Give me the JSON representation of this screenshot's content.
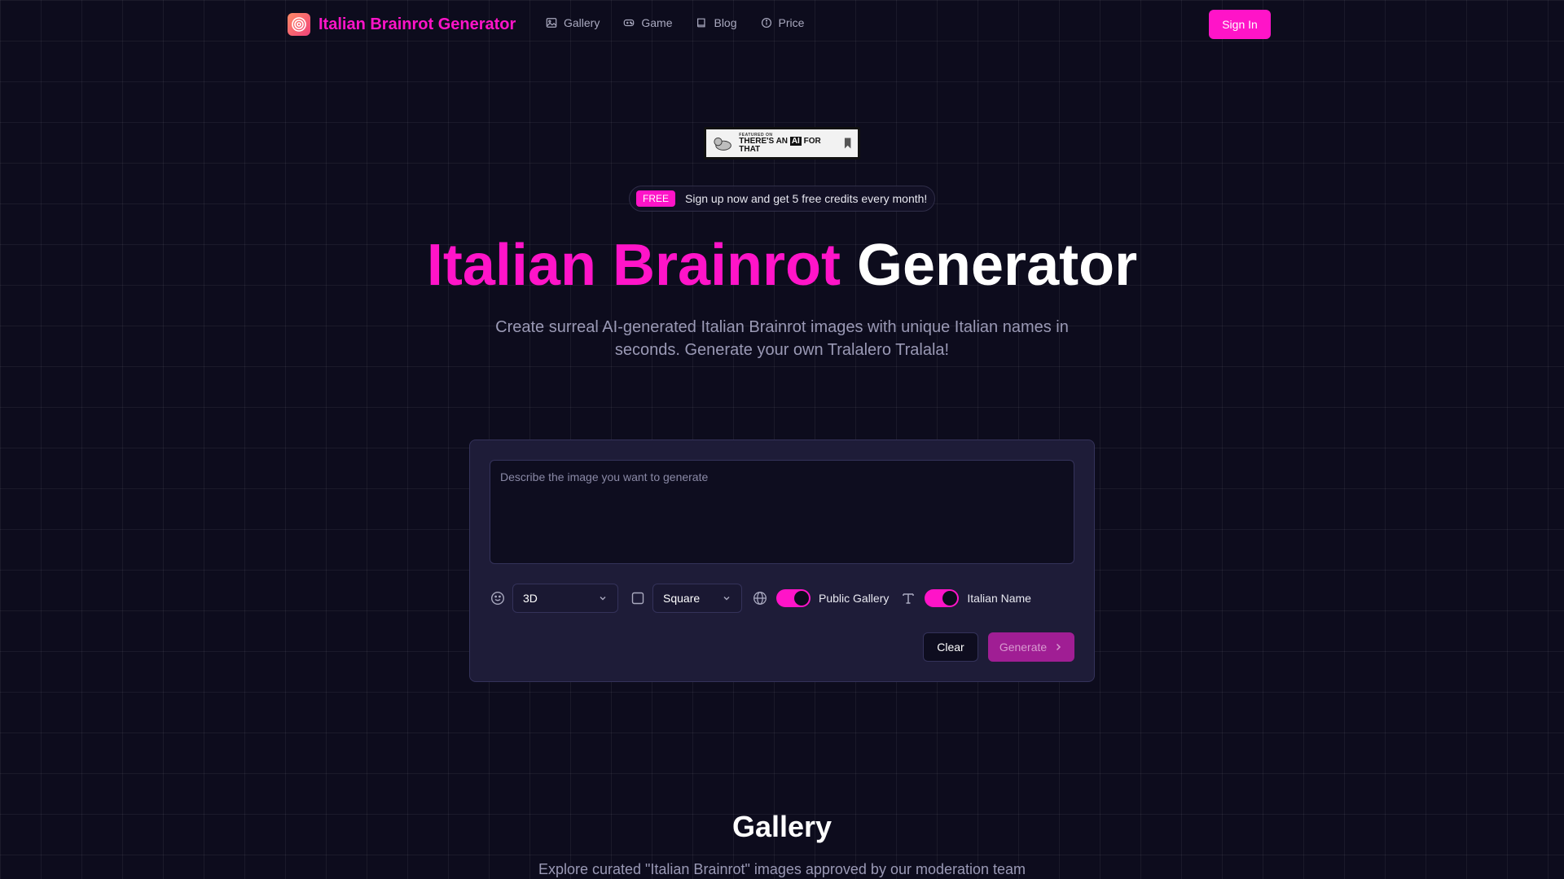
{
  "brand": {
    "name": "Italian Brainrot Generator",
    "accent": "#ff14c8"
  },
  "nav": {
    "items": [
      {
        "label": "Gallery",
        "icon": "image-icon"
      },
      {
        "label": "Game",
        "icon": "gamepad-icon"
      },
      {
        "label": "Blog",
        "icon": "book-icon"
      },
      {
        "label": "Price",
        "icon": "info-icon"
      }
    ],
    "signin_label": "Sign In"
  },
  "featured_badge": {
    "small": "FEATURED ON",
    "line_a": "THERE'S AN ",
    "line_ai": "AI",
    "line_b": " FOR THAT"
  },
  "promo": {
    "badge": "FREE",
    "text": "Sign up now and get 5 free credits every month!"
  },
  "hero": {
    "title_accent": "Italian Brainrot",
    "title_plain": "Generator",
    "subtitle": "Create surreal AI-generated Italian Brainrot images with unique Italian names in seconds. Generate your own Tralalero Tralala!"
  },
  "generator": {
    "prompt_placeholder": "Describe the image you want to generate",
    "prompt_value": "",
    "style_value": "3D",
    "aspect_value": "Square",
    "public_gallery_label": "Public Gallery",
    "public_gallery_on": true,
    "italian_name_label": "Italian Name",
    "italian_name_on": true,
    "clear_label": "Clear",
    "generate_label": "Generate"
  },
  "gallery": {
    "title": "Gallery",
    "subtitle": "Explore curated \"Italian Brainrot\" images approved by our moderation team"
  }
}
